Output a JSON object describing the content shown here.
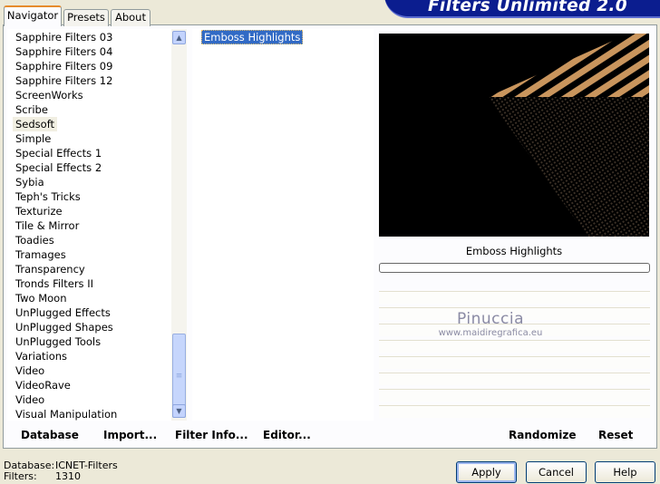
{
  "tabs": [
    "Navigator",
    "Presets",
    "About"
  ],
  "brand": "Filters Unlimited 2.0",
  "categories": [
    "Sapphire Filters 03",
    "Sapphire Filters 04",
    "Sapphire Filters 09",
    "Sapphire Filters 12",
    "ScreenWorks",
    "Scribe",
    "Sedsoft",
    "Simple",
    "Special Effects 1",
    "Special Effects 2",
    "Sybia",
    "Teph's Tricks",
    "Texturize",
    "Tile & Mirror",
    "Toadies",
    "Tramages",
    "Transparency",
    "Tronds Filters II",
    "Two Moon",
    "UnPlugged Effects",
    "UnPlugged Shapes",
    "UnPlugged Tools",
    "Variations",
    "Video",
    "VideoRave",
    "Video",
    "Visual Manipulation"
  ],
  "selected_category_index": 6,
  "filters": [
    "Emboss Highlights"
  ],
  "preview": {
    "title": "Emboss Highlights"
  },
  "watermark": {
    "name": "Pinuccia",
    "url": "www.maidiregrafica.eu"
  },
  "left_buttons": [
    "Database",
    "Import...",
    "Filter Info...",
    "Editor..."
  ],
  "right_buttons": [
    "Randomize",
    "Reset"
  ],
  "status": {
    "database_label": "Database:",
    "database_value": "ICNET-Filters",
    "filters_label": "Filters:",
    "filters_value": "1310"
  },
  "dialog_buttons": {
    "apply": "Apply",
    "cancel": "Cancel",
    "help": "Help"
  },
  "icons": {
    "scroll_up": "chevron-up-icon",
    "scroll_down": "chevron-down-icon",
    "grip": "grip-icon"
  },
  "colors": {
    "selection": "#316ac5",
    "brand_bg": "#0b1d8f",
    "tab_accent": "#e68b2c",
    "stripe": "#c9955d"
  }
}
